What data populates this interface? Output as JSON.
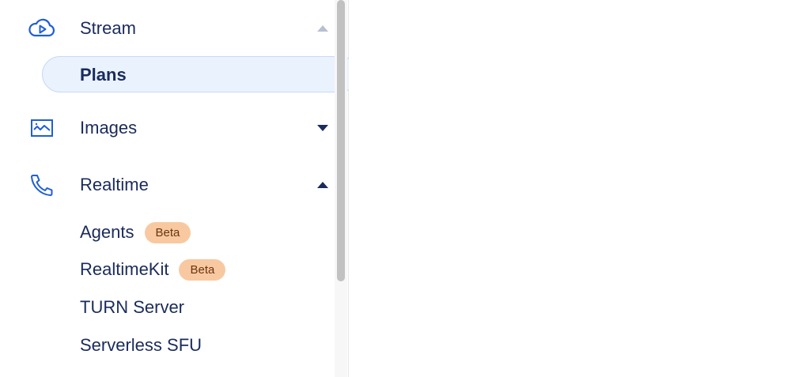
{
  "sidebar": {
    "stream": {
      "label": "Stream",
      "icon": "cloud-play-icon",
      "expanded": true
    },
    "stream_children": [
      {
        "label": "Plans",
        "selected": true
      }
    ],
    "images": {
      "label": "Images",
      "icon": "image-icon",
      "expanded": false
    },
    "realtime": {
      "label": "Realtime",
      "icon": "phone-icon",
      "expanded": true
    },
    "realtime_children": [
      {
        "label": "Agents",
        "badge": "Beta"
      },
      {
        "label": "RealtimeKit",
        "badge": "Beta"
      },
      {
        "label": "TURN Server"
      },
      {
        "label": "Serverless SFU"
      }
    ]
  },
  "colors": {
    "text": "#1a2b5c",
    "icon": "#1f5fd6",
    "selected_bg": "#eaf2fd",
    "badge_bg": "#f8c9a0"
  }
}
